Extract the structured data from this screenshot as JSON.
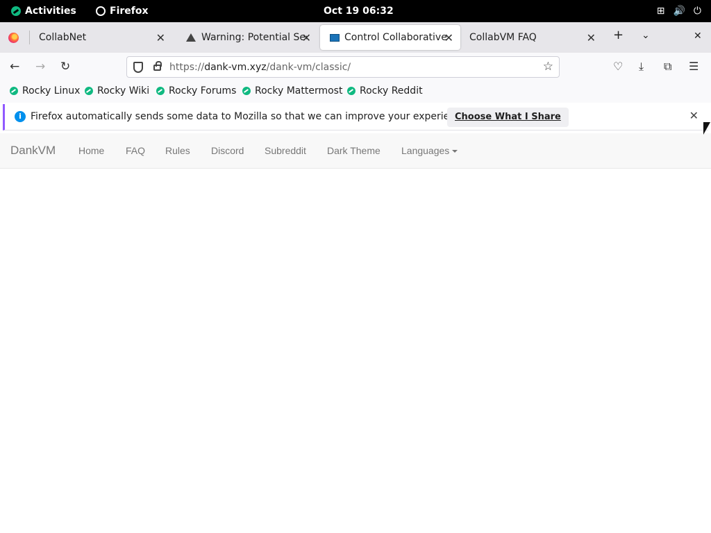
{
  "system_bar": {
    "activities_label": "Activities",
    "app_label": "Firefox",
    "clock": "Oct 19  06:32"
  },
  "tabs": [
    {
      "label": "CollabNet",
      "icon": "firefox-icon"
    },
    {
      "label": "Warning: Potential Security Risk Ahead",
      "icon": "warning-icon"
    },
    {
      "label": "Control Collaborative Virtual Machines!",
      "icon": "vm-icon",
      "active": true
    },
    {
      "label": "CollabVM FAQ",
      "icon": ""
    }
  ],
  "urlbar": {
    "scheme": "https://",
    "domain": "dank-vm.xyz",
    "path": "/dank-vm/classic/"
  },
  "bookmarks": [
    "Rocky Linux",
    "Rocky Wiki",
    "Rocky Forums",
    "Rocky Mattermost",
    "Rocky Reddit"
  ],
  "notification": {
    "message": "Firefox automatically sends some data to Mozilla so that we can improve your experience.",
    "button_label": "Choose What I Share"
  },
  "site": {
    "brand": "DankVM",
    "links": [
      "Home",
      "FAQ",
      "Rules",
      "Discord",
      "Subreddit",
      "Dark Theme",
      "Languages"
    ]
  }
}
